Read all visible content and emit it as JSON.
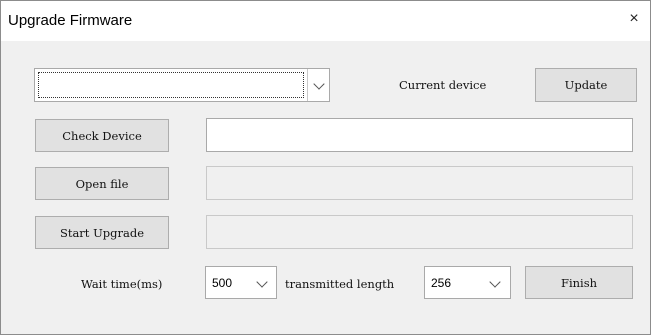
{
  "window": {
    "title": "Upgrade Firmware",
    "close_glyph": "×"
  },
  "device_combo": {
    "selected": ""
  },
  "labels": {
    "current_device": "Current device",
    "wait_time": "Wait time(ms)",
    "transmitted_length": "transmitted length"
  },
  "buttons": {
    "update": "Update",
    "check_device": "Check Device",
    "open_file": "Open file",
    "start_upgrade": "Start Upgrade",
    "finish": "Finish"
  },
  "fields": {
    "device_info": "",
    "file_path": "",
    "upgrade_status": ""
  },
  "wait_time_select": {
    "selected": "500"
  },
  "length_select": {
    "selected": "256"
  },
  "icons": {
    "close": "close-icon",
    "dropdown": "chevron-down-icon"
  }
}
